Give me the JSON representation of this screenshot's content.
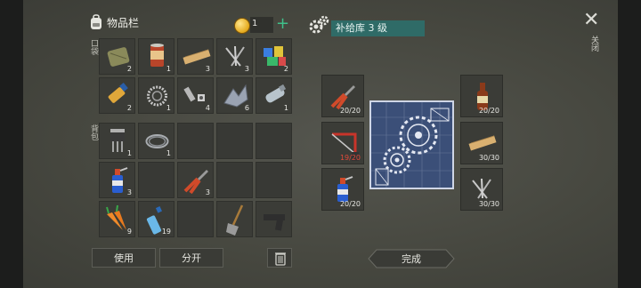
{
  "inventory": {
    "title": "物品栏",
    "coins": "1",
    "pockets_label": "口袋",
    "backpack_label": "背包",
    "use_label": "使用",
    "split_label": "分开",
    "slots": [
      {
        "item": "cloth-bundle",
        "count": "2"
      },
      {
        "item": "canned-food",
        "count": "1"
      },
      {
        "item": "wood-plank",
        "count": "3"
      },
      {
        "item": "nails",
        "count": "3"
      },
      {
        "item": "colored-boxes",
        "count": "2"
      },
      {
        "item": "glue-tube",
        "count": "2"
      },
      {
        "item": "bearing-ring",
        "count": "1"
      },
      {
        "item": "bolts",
        "count": "4"
      },
      {
        "item": "scrap-metal",
        "count": "6"
      },
      {
        "item": "spring",
        "count": "1"
      },
      {
        "item": "transistor",
        "count": "1"
      },
      {
        "item": "wire-coil",
        "count": "1"
      },
      {
        "item": "empty",
        "count": ""
      },
      {
        "item": "empty",
        "count": ""
      },
      {
        "item": "empty",
        "count": ""
      },
      {
        "item": "gas-canister",
        "count": "3"
      },
      {
        "item": "empty",
        "count": ""
      },
      {
        "item": "pliers",
        "count": "3"
      },
      {
        "item": "empty",
        "count": ""
      },
      {
        "item": "empty",
        "count": ""
      },
      {
        "item": "carrots",
        "count": "9"
      },
      {
        "item": "water-bottle",
        "count": "19"
      },
      {
        "item": "empty",
        "count": ""
      },
      {
        "item": "shovel",
        "count": ""
      },
      {
        "item": "pistol",
        "count": ""
      }
    ]
  },
  "craft": {
    "title": "补给库 3 级",
    "close_label": "关闭",
    "done_label": "完成",
    "inputs": [
      {
        "item": "pliers",
        "count": "20/20",
        "short": false
      },
      {
        "item": "hacksaw",
        "count": "19/20",
        "short": true
      },
      {
        "item": "gas-canister",
        "count": "20/20",
        "short": false
      }
    ],
    "outputs": [
      {
        "item": "liquor-bottle",
        "count": "20/20"
      },
      {
        "item": "wood-plank",
        "count": "30/30"
      },
      {
        "item": "nails",
        "count": "30/30"
      }
    ]
  },
  "colors": {
    "accent_teal": "#2f6b67",
    "coin_gold": "#e4a91c",
    "shortage_red": "#e04a3a",
    "add_green": "#3fc08a"
  }
}
